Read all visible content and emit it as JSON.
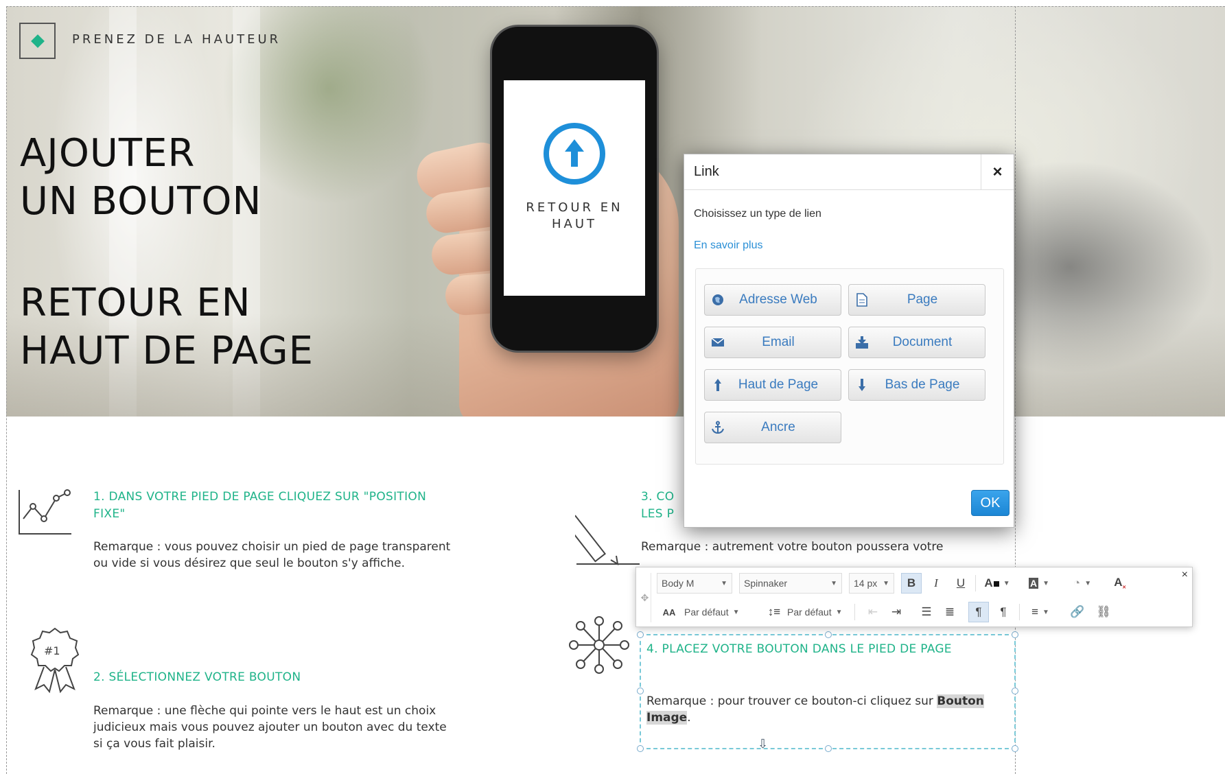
{
  "brand": {
    "name": "PRENEZ DE LA HAUTEUR"
  },
  "hero": {
    "title_line1": "AJOUTER\nUN BOUTON",
    "title_line2": "RETOUR EN\nHAUT DE PAGE",
    "phone_label": "RETOUR EN\nHAUT"
  },
  "steps": [
    {
      "title": "1. DANS VOTRE PIED DE PAGE CLIQUEZ SUR \"POSITION FIXE\"",
      "text": "Remarque : vous pouvez choisir un pied de page transparent ou vide si vous désirez que seul le bouton s'y affiche.",
      "icon": "line-chart-icon"
    },
    {
      "title": "2. SÉLECTIONNEZ VOTRE BOUTON",
      "text": "Remarque : une flèche qui pointe vers le haut est un choix judicieux mais vous pouvez ajouter un bouton avec du texte si ça vous fait plaisir.",
      "icon": "award-ribbon-icon"
    },
    {
      "title": "3. CO",
      "title_line2": "LES P",
      "text": "Remarque : autrement votre bouton poussera votre",
      "icon": "pencil-icon"
    },
    {
      "title": "4. PLACEZ VOTRE BOUTON DANS LE PIED DE PAGE",
      "text_before": "Remarque : pour trouver ce bouton-ci cliquez sur",
      "text_bold": "Bouton Image",
      "text_after": ".",
      "icon": "network-icon"
    }
  ],
  "dialog": {
    "title": "Link",
    "close": "×",
    "prompt": "Choisissez un type de lien",
    "more_link": "En savoir plus",
    "buttons": [
      {
        "label": "Adresse Web",
        "icon": "globe-icon"
      },
      {
        "label": "Page",
        "icon": "page-icon"
      },
      {
        "label": "Email",
        "icon": "envelope-icon"
      },
      {
        "label": "Document",
        "icon": "download-icon"
      },
      {
        "label": "Haut de Page",
        "icon": "arrow-up-icon"
      },
      {
        "label": "Bas de Page",
        "icon": "arrow-down-icon"
      },
      {
        "label": "Ancre",
        "icon": "anchor-icon"
      }
    ],
    "ok": "OK"
  },
  "toolbar": {
    "style": "Body M",
    "font": "Spinnaker",
    "size": "14 px",
    "bold": "B",
    "italic": "I",
    "underline": "U",
    "letter_spacing_icon": "AA",
    "letter_spacing": "Par défaut",
    "line_height": "Par défaut",
    "close": "×"
  },
  "colors": {
    "accent": "#1fb389",
    "link": "#2a8fd6",
    "ok": "#1c86d4",
    "phone_icon": "#1e8fd9"
  }
}
